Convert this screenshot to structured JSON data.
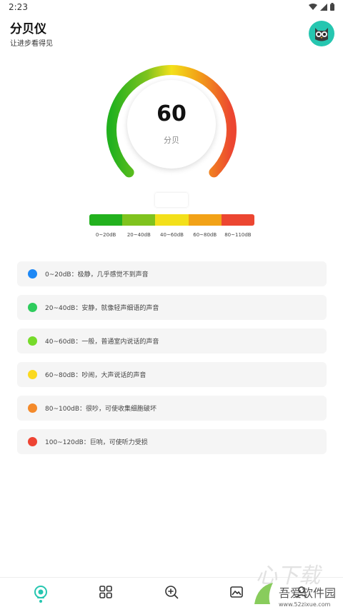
{
  "status_bar": {
    "time": "2:23"
  },
  "header": {
    "title": "分贝仪",
    "subtitle": "让进步看得见"
  },
  "gauge": {
    "value": "60",
    "unit": "分贝"
  },
  "scale": {
    "segments": [
      {
        "label": "0~20dB",
        "color": "#22b11e"
      },
      {
        "label": "20~40dB",
        "color": "#7fc31e"
      },
      {
        "label": "40~60dB",
        "color": "#f3e01a"
      },
      {
        "label": "60~80dB",
        "color": "#f2a217"
      },
      {
        "label": "80~110dB",
        "color": "#ec4631"
      }
    ]
  },
  "levels": [
    {
      "text": "0~20dB：极静，几乎感觉不到声音",
      "color": "#1e88f5"
    },
    {
      "text": "20~40dB：安静，就像轻声细语的声音",
      "color": "#2ecc5d"
    },
    {
      "text": "40~60dB：一般，普通室内说话的声音",
      "color": "#76db2a"
    },
    {
      "text": "60~80dB：吵闹，大声说话的声音",
      "color": "#fbd91f"
    },
    {
      "text": "80~100dB：很吵，可使收集细胞破坏",
      "color": "#f48a2a"
    },
    {
      "text": "100~120dB：巨响，可使听力受损",
      "color": "#ee4433"
    }
  ],
  "nav": {
    "items": [
      {
        "icon": "meter-icon"
      },
      {
        "icon": "grid-icon"
      },
      {
        "icon": "zoom-icon"
      },
      {
        "icon": "image-icon"
      },
      {
        "icon": "profile-icon"
      }
    ],
    "accent": "#26c6b0"
  },
  "watermark": {
    "text": "吾爱软件园",
    "url": "www.52zixue.com"
  }
}
